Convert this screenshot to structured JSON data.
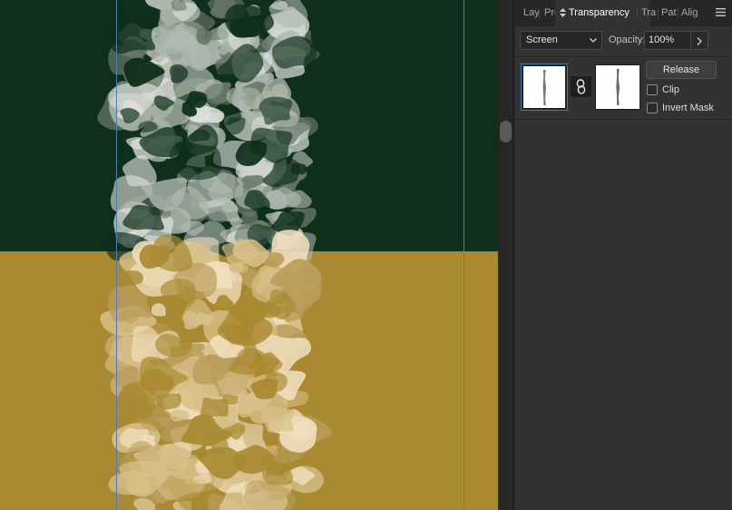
{
  "canvas": {
    "colors": {
      "top_band": "#0e2f1c",
      "bottom_band": "#a98932",
      "guide": "#4a7fbd",
      "texture_light": "#dfe3dc",
      "texture_mid": "#aeb7ad",
      "texture_dark": "#667668",
      "texture_light_gold": "#f0dfbd",
      "texture_mid_gold": "#d8c08a",
      "texture_dark_gold": "#bb9e5c"
    }
  },
  "panel": {
    "tabs": [
      {
        "label": "Lay",
        "name": "tab-layers"
      },
      {
        "label": "Pro",
        "name": "tab-properties"
      },
      {
        "label": "Transparency",
        "name": "tab-transparency",
        "active": true
      },
      {
        "label": "Tra",
        "name": "tab-transform"
      },
      {
        "label": "Pat",
        "name": "tab-pathfinder"
      },
      {
        "label": "Alig",
        "name": "tab-align"
      }
    ],
    "blend_mode": "Screen",
    "opacity_label": "Opacity:",
    "opacity_value": "100%",
    "release_label": "Release",
    "clip_label": "Clip",
    "invert_mask_label": "Invert Mask",
    "clip_checked": false,
    "invert_mask_checked": false
  },
  "icons": [
    "updown-arrows-icon",
    "panel-menu-icon",
    "chevron-down-icon",
    "chevron-right-icon",
    "link-chain-icon",
    "art-thumbnail",
    "mask-thumbnail"
  ]
}
